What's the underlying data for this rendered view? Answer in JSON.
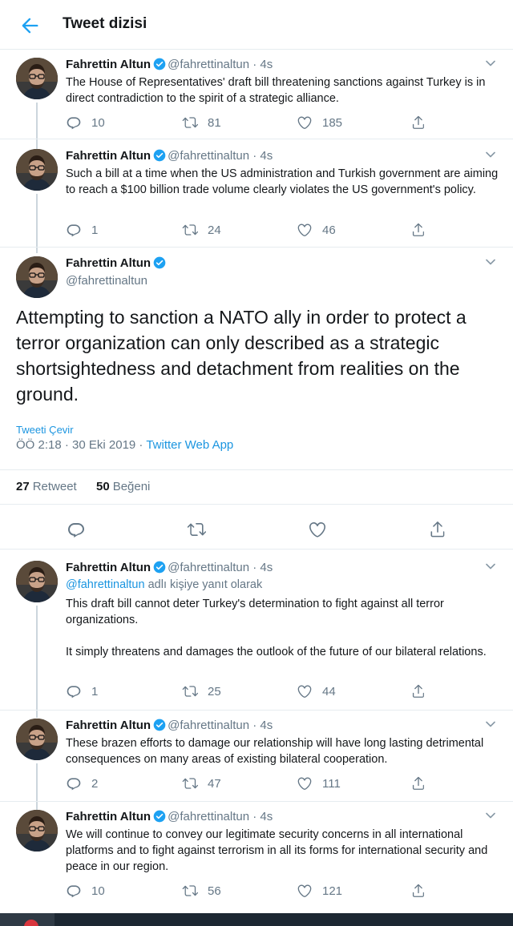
{
  "header": {
    "title": "Tweet dizisi",
    "back_icon": "arrow-left-icon"
  },
  "colors": {
    "accent": "#1b95e0",
    "verified": "#1da1f2",
    "muted": "#657786",
    "text": "#14171a"
  },
  "author": {
    "name": "Fahrettin Altun",
    "handle": "@fahrettinaltun"
  },
  "thread_before": [
    {
      "name": "Fahrettin Altun",
      "handle_time": "@fahrettinaltun · 4s",
      "text": "The House of Representatives' draft bill threatening sanctions against Turkey is in direct contradiction to the spirit of a strategic alliance.",
      "replies": "10",
      "retweets": "81",
      "likes": "185"
    },
    {
      "name": "Fahrettin Altun",
      "handle_time": "@fahrettinaltun · 4s",
      "text": "Such a bill at a time when the US administration and Turkish government are aiming to reach a $100 billion trade volume clearly violates the US government's policy.",
      "replies": "1",
      "retweets": "24",
      "likes": "46"
    }
  ],
  "main_tweet": {
    "name": "Fahrettin Altun",
    "handle": "@fahrettinaltun",
    "text": "Attempting to sanction a NATO ally in order to protect a terror organization can only described as a strategic shortsightedness and detachment from realities on the ground.",
    "translate_label": "Tweeti Çevir",
    "timestamp": "ÖÖ 2:18 · 30 Eki 2019 · ",
    "app": "Twitter Web App",
    "retweet_count": "27",
    "retweet_label": "Retweet",
    "like_count": "50",
    "like_label": "Beğeni"
  },
  "replies": [
    {
      "name": "Fahrettin Altun",
      "handle_time": "@fahrettinaltun · 4s",
      "reply_to_link": "@fahrettinaltun",
      "reply_to_suffix": " adlı kişiye yanıt olarak",
      "text_p1": "This draft bill cannot deter Turkey's determination to fight against all terror organizations.",
      "text_p2": "It simply threatens and damages the outlook of the future of our bilateral relations.",
      "replies": "1",
      "retweets": "25",
      "likes": "44"
    },
    {
      "name": "Fahrettin Altun",
      "handle_time": "@fahrettinaltun · 4s",
      "text": "These brazen efforts to damage our relationship will have long lasting detrimental consequences on many areas of existing bilateral cooperation.",
      "replies": "2",
      "retweets": "47",
      "likes": "111"
    },
    {
      "name": "Fahrettin Altun",
      "handle_time": "@fahrettinaltun · 4s",
      "text": "We will continue to convey our legitimate security concerns in all international platforms and to fight against terrorism in all its forms for international security and peace in our region.",
      "replies": "10",
      "retweets": "56",
      "likes": "121"
    }
  ]
}
